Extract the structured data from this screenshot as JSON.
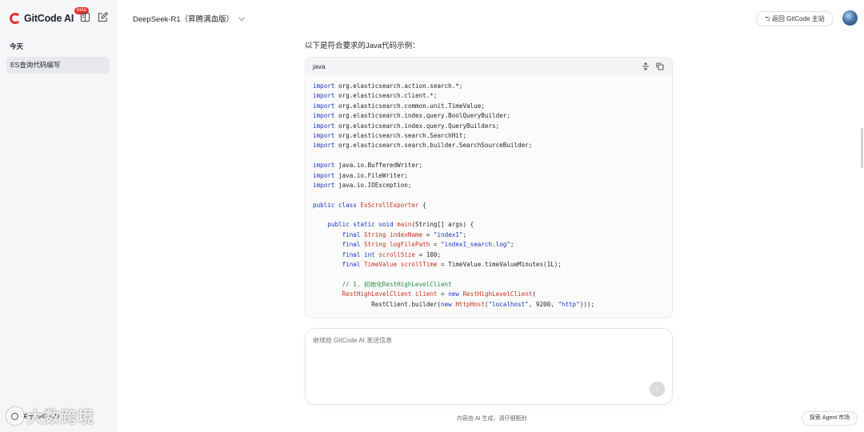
{
  "sidebar": {
    "brand": "GitCode AI",
    "beta": "beta",
    "section_today": "今天",
    "chat_items": [
      {
        "label": "ES查询代码编写"
      }
    ],
    "about": "关于 GitCode",
    "watermark": "大数跨境",
    "icons": [
      "brand-g-icon",
      "sidebar-toggle-icon",
      "new-chat-icon",
      "info-icon"
    ]
  },
  "header": {
    "model": "DeepSeek-R1（昇腾满血版）",
    "back_button": "返回 GitCode 主站",
    "back_icon": "return-icon"
  },
  "message": {
    "intro": "以下是符合要求的Java代码示例：",
    "code_lang": "java",
    "code_icons": [
      "collapse-icon",
      "copy-icon"
    ]
  },
  "code": [
    [
      [
        "kw",
        "import"
      ],
      [
        "t",
        " org.elasticsearch.action.search.*;"
      ]
    ],
    [
      [
        "kw",
        "import"
      ],
      [
        "t",
        " org.elasticsearch.client.*;"
      ]
    ],
    [
      [
        "kw",
        "import"
      ],
      [
        "t",
        " org.elasticsearch.common.unit.TimeValue;"
      ]
    ],
    [
      [
        "kw",
        "import"
      ],
      [
        "t",
        " org.elasticsearch.index.query.BoolQueryBuilder;"
      ]
    ],
    [
      [
        "kw",
        "import"
      ],
      [
        "t",
        " org.elasticsearch.index.query.QueryBuilders;"
      ]
    ],
    [
      [
        "kw",
        "import"
      ],
      [
        "t",
        " org.elasticsearch.search.SearchHit;"
      ]
    ],
    [
      [
        "kw",
        "import"
      ],
      [
        "t",
        " org.elasticsearch.search.builder.SearchSourceBuilder;"
      ]
    ],
    [],
    [
      [
        "kw",
        "import"
      ],
      [
        "t",
        " java.io.BufferedWriter;"
      ]
    ],
    [
      [
        "kw",
        "import"
      ],
      [
        "t",
        " java.io.FileWriter;"
      ]
    ],
    [
      [
        "kw",
        "import"
      ],
      [
        "t",
        " java.io.IOException;"
      ]
    ],
    [],
    [
      [
        "kw",
        "public"
      ],
      [
        "t",
        " "
      ],
      [
        "kw",
        "class"
      ],
      [
        "t",
        " "
      ],
      [
        "ty",
        "EsScrollExporter"
      ],
      [
        "t",
        " {"
      ]
    ],
    [],
    [
      [
        "t",
        "    "
      ],
      [
        "kw",
        "public static void"
      ],
      [
        "t",
        " "
      ],
      [
        "ty",
        "main"
      ],
      [
        "t",
        "(String[] args) {"
      ]
    ],
    [
      [
        "t",
        "        "
      ],
      [
        "kw",
        "final"
      ],
      [
        "t",
        " "
      ],
      [
        "ty",
        "String"
      ],
      [
        "t",
        " "
      ],
      [
        "var",
        "indexName"
      ],
      [
        "t",
        " = "
      ],
      [
        "str",
        "\"index1\""
      ],
      [
        "t",
        ";"
      ]
    ],
    [
      [
        "t",
        "        "
      ],
      [
        "kw",
        "final"
      ],
      [
        "t",
        " "
      ],
      [
        "ty",
        "String"
      ],
      [
        "t",
        " "
      ],
      [
        "var",
        "logFilePath"
      ],
      [
        "t",
        " = "
      ],
      [
        "str",
        "\"index1_search.log\""
      ],
      [
        "t",
        ";"
      ]
    ],
    [
      [
        "t",
        "        "
      ],
      [
        "kw",
        "final"
      ],
      [
        "t",
        " "
      ],
      [
        "kw",
        "int"
      ],
      [
        "t",
        " "
      ],
      [
        "var",
        "scrollSize"
      ],
      [
        "t",
        " = 100;"
      ]
    ],
    [
      [
        "t",
        "        "
      ],
      [
        "kw",
        "final"
      ],
      [
        "t",
        " "
      ],
      [
        "ty",
        "TimeValue"
      ],
      [
        "t",
        " "
      ],
      [
        "var",
        "scrollTime"
      ],
      [
        "t",
        " = TimeValue.timeValueMinutes(1L);"
      ]
    ],
    [],
    [
      [
        "t",
        "        "
      ],
      [
        "cm",
        "// 1. 初始化RestHighLevelClient"
      ]
    ],
    [
      [
        "t",
        "        "
      ],
      [
        "ty",
        "RestHighLevelClient"
      ],
      [
        "t",
        " "
      ],
      [
        "var",
        "client"
      ],
      [
        "t",
        " = "
      ],
      [
        "kw",
        "new"
      ],
      [
        "t",
        " "
      ],
      [
        "ty",
        "RestHighLevelClient"
      ],
      [
        "t",
        "("
      ]
    ],
    [
      [
        "t",
        "                RestClient.builder("
      ],
      [
        "kw",
        "new"
      ],
      [
        "t",
        " "
      ],
      [
        "ty",
        "HttpHost"
      ],
      [
        "t",
        "("
      ],
      [
        "str",
        "\"localhost\""
      ],
      [
        "t",
        ", 9200, "
      ],
      [
        "str",
        "\"http\""
      ],
      [
        "t",
        ")));"
      ]
    ]
  ],
  "input": {
    "placeholder": "继续给 GitCode AI 发送信息",
    "send_icon": "send-arrow-icon"
  },
  "footer": {
    "note": "内容由 AI 生成，请仔细甄别",
    "agent_button": "探索 Agent 市场"
  }
}
